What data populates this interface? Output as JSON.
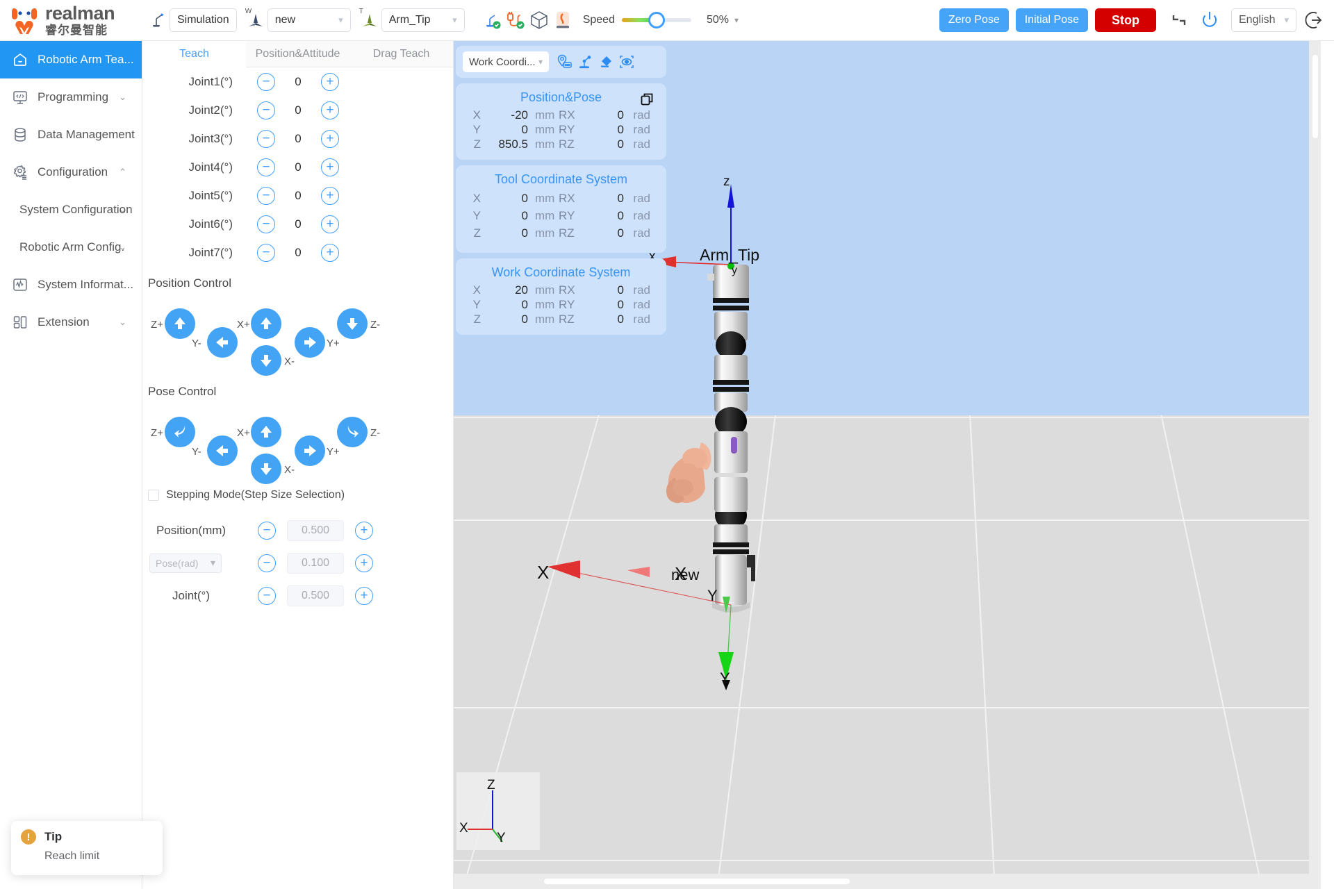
{
  "brand": {
    "en": "realman",
    "cn": "睿尔曼智能",
    "logo_icon": "realman-logo-icon"
  },
  "topbar": {
    "robot_status_icon": "robot-arm-icon",
    "mode_label": "Simulation",
    "work_frame_icon": "work-frame-axes-icon",
    "work_frame_sup": "W",
    "work_frame_value": "new",
    "tool_frame_icon": "tool-frame-axes-icon",
    "tool_frame_sup": "T",
    "tool_frame_value": "Arm_Tip",
    "status_icons": [
      {
        "name": "robot-connected-icon"
      },
      {
        "name": "cable-connected-icon"
      },
      {
        "name": "cube-model-icon"
      },
      {
        "name": "collision-detect-icon"
      }
    ],
    "speed_label": "Speed",
    "speed_value": "50%",
    "speed_percent": 50,
    "zero_pose_label": "Zero Pose",
    "initial_pose_label": "Initial Pose",
    "stop_label": "Stop",
    "collapse_icon": "collapse-corner-icon",
    "power_icon": "power-icon",
    "language_value": "English",
    "logout_icon": "logout-icon",
    "accent_blue": "#45a4f8",
    "stop_red": "#d40000"
  },
  "sidebar": {
    "items": [
      {
        "label": "Robotic Arm Tea...",
        "icon": "home-icon",
        "active": true,
        "arrow": ""
      },
      {
        "label": "Programming",
        "icon": "code-screen-icon",
        "active": false,
        "arrow": "⌄"
      },
      {
        "label": "Data Management",
        "icon": "database-icon",
        "active": false,
        "arrow": ""
      },
      {
        "label": "Configuration",
        "icon": "gear-list-icon",
        "active": false,
        "arrow": "⌃"
      }
    ],
    "sub_items": [
      {
        "label": "System Configuration",
        "arrow": "⌄"
      },
      {
        "label": "Robotic Arm Config.",
        "arrow": "⌄"
      }
    ],
    "items_after": [
      {
        "label": "System Informat...",
        "icon": "waveform-icon",
        "arrow": ""
      },
      {
        "label": "Extension",
        "icon": "modules-icon",
        "arrow": "⌄"
      }
    ]
  },
  "teach": {
    "tabs": [
      {
        "label": "Teach",
        "active": true
      },
      {
        "label": "Position&Attitude",
        "active": false
      },
      {
        "label": "Drag Teach",
        "active": false
      }
    ],
    "joints": [
      {
        "label": "Joint1(°)",
        "value": "0"
      },
      {
        "label": "Joint2(°)",
        "value": "0"
      },
      {
        "label": "Joint3(°)",
        "value": "0"
      },
      {
        "label": "Joint4(°)",
        "value": "0"
      },
      {
        "label": "Joint5(°)",
        "value": "0"
      },
      {
        "label": "Joint6(°)",
        "value": "0"
      },
      {
        "label": "Joint7(°)",
        "value": "0"
      }
    ],
    "minus_glyph": "−",
    "plus_glyph": "+",
    "position_control_title": "Position Control",
    "pose_control_title": "Pose Control",
    "position_pad": {
      "zp": "Z+",
      "zm": "Z-",
      "ym": "Y-",
      "yp": "Y+",
      "xp": "X+",
      "xm": "X-"
    },
    "pose_pad": {
      "zp": "Z+",
      "zm": "Z-",
      "ym": "Y-",
      "yp": "Y+",
      "xp": "X+",
      "xm": "X-"
    },
    "stepping_label": "Stepping Mode(Step Size Selection)",
    "stepping_checked": false,
    "steps": [
      {
        "label": "Position(mm)",
        "is_select": false,
        "value": "0.500"
      },
      {
        "label": "Pose(rad)",
        "is_select": true,
        "value": "0.100"
      },
      {
        "label": "Joint(°)",
        "is_select": false,
        "value": "0.500"
      }
    ]
  },
  "coords": {
    "selector_value": "Work Coordi...",
    "tool_icons": [
      {
        "name": "waypoint-tag-icon"
      },
      {
        "name": "robot-teach-icon"
      },
      {
        "name": "eraser-icon"
      },
      {
        "name": "focus-eye-icon"
      }
    ],
    "panels": [
      {
        "title": "Position&Pose",
        "has_copy": true,
        "copy_icon": "copy-icon",
        "rows": [
          {
            "axis": "X",
            "value": "-20",
            "unit": "mm",
            "raxis": "RX",
            "rvalue": "0",
            "runit": "rad"
          },
          {
            "axis": "Y",
            "value": "0",
            "unit": "mm",
            "raxis": "RY",
            "rvalue": "0",
            "runit": "rad"
          },
          {
            "axis": "Z",
            "value": "850.5",
            "unit": "mm",
            "raxis": "RZ",
            "rvalue": "0",
            "runit": "rad"
          }
        ]
      },
      {
        "title": "Tool Coordinate System",
        "has_copy": false,
        "rows": [
          {
            "axis": "X",
            "value": "0",
            "unit": "mm",
            "raxis": "RX",
            "rvalue": "0",
            "runit": "rad"
          },
          {
            "axis": "Y",
            "value": "0",
            "unit": "mm",
            "raxis": "RY",
            "rvalue": "0",
            "runit": "rad"
          },
          {
            "axis": "Z",
            "value": "0",
            "unit": "mm",
            "raxis": "RZ",
            "rvalue": "0",
            "runit": "rad"
          }
        ]
      },
      {
        "title": "Work Coordinate System",
        "has_copy": false,
        "rows": [
          {
            "axis": "X",
            "value": "20",
            "unit": "mm",
            "raxis": "RX",
            "rvalue": "0",
            "runit": "rad"
          },
          {
            "axis": "Y",
            "value": "0",
            "unit": "mm",
            "raxis": "RY",
            "rvalue": "0",
            "runit": "rad"
          },
          {
            "axis": "Z",
            "value": "0",
            "unit": "mm",
            "raxis": "RZ",
            "rvalue": "0",
            "runit": "rad"
          }
        ]
      }
    ]
  },
  "viewport": {
    "arm_tip_label": "Arm_Tip",
    "tip_axis_z": "z",
    "tip_axis_x": "x",
    "tip_axis_y": "y",
    "base_frame_label": "new",
    "base_axis_x1": "X",
    "base_axis_x2": "X",
    "base_axis_y1": "Y",
    "base_axis_y2": "Y",
    "gizmo_z": "Z",
    "gizmo_x": "X",
    "gizmo_y": "Y",
    "sky_color": "#b9d4f5",
    "ground_color": "#dcdcdc"
  },
  "toast": {
    "icon": "warning-icon",
    "glyph": "!",
    "title": "Tip",
    "message": "Reach limit"
  }
}
